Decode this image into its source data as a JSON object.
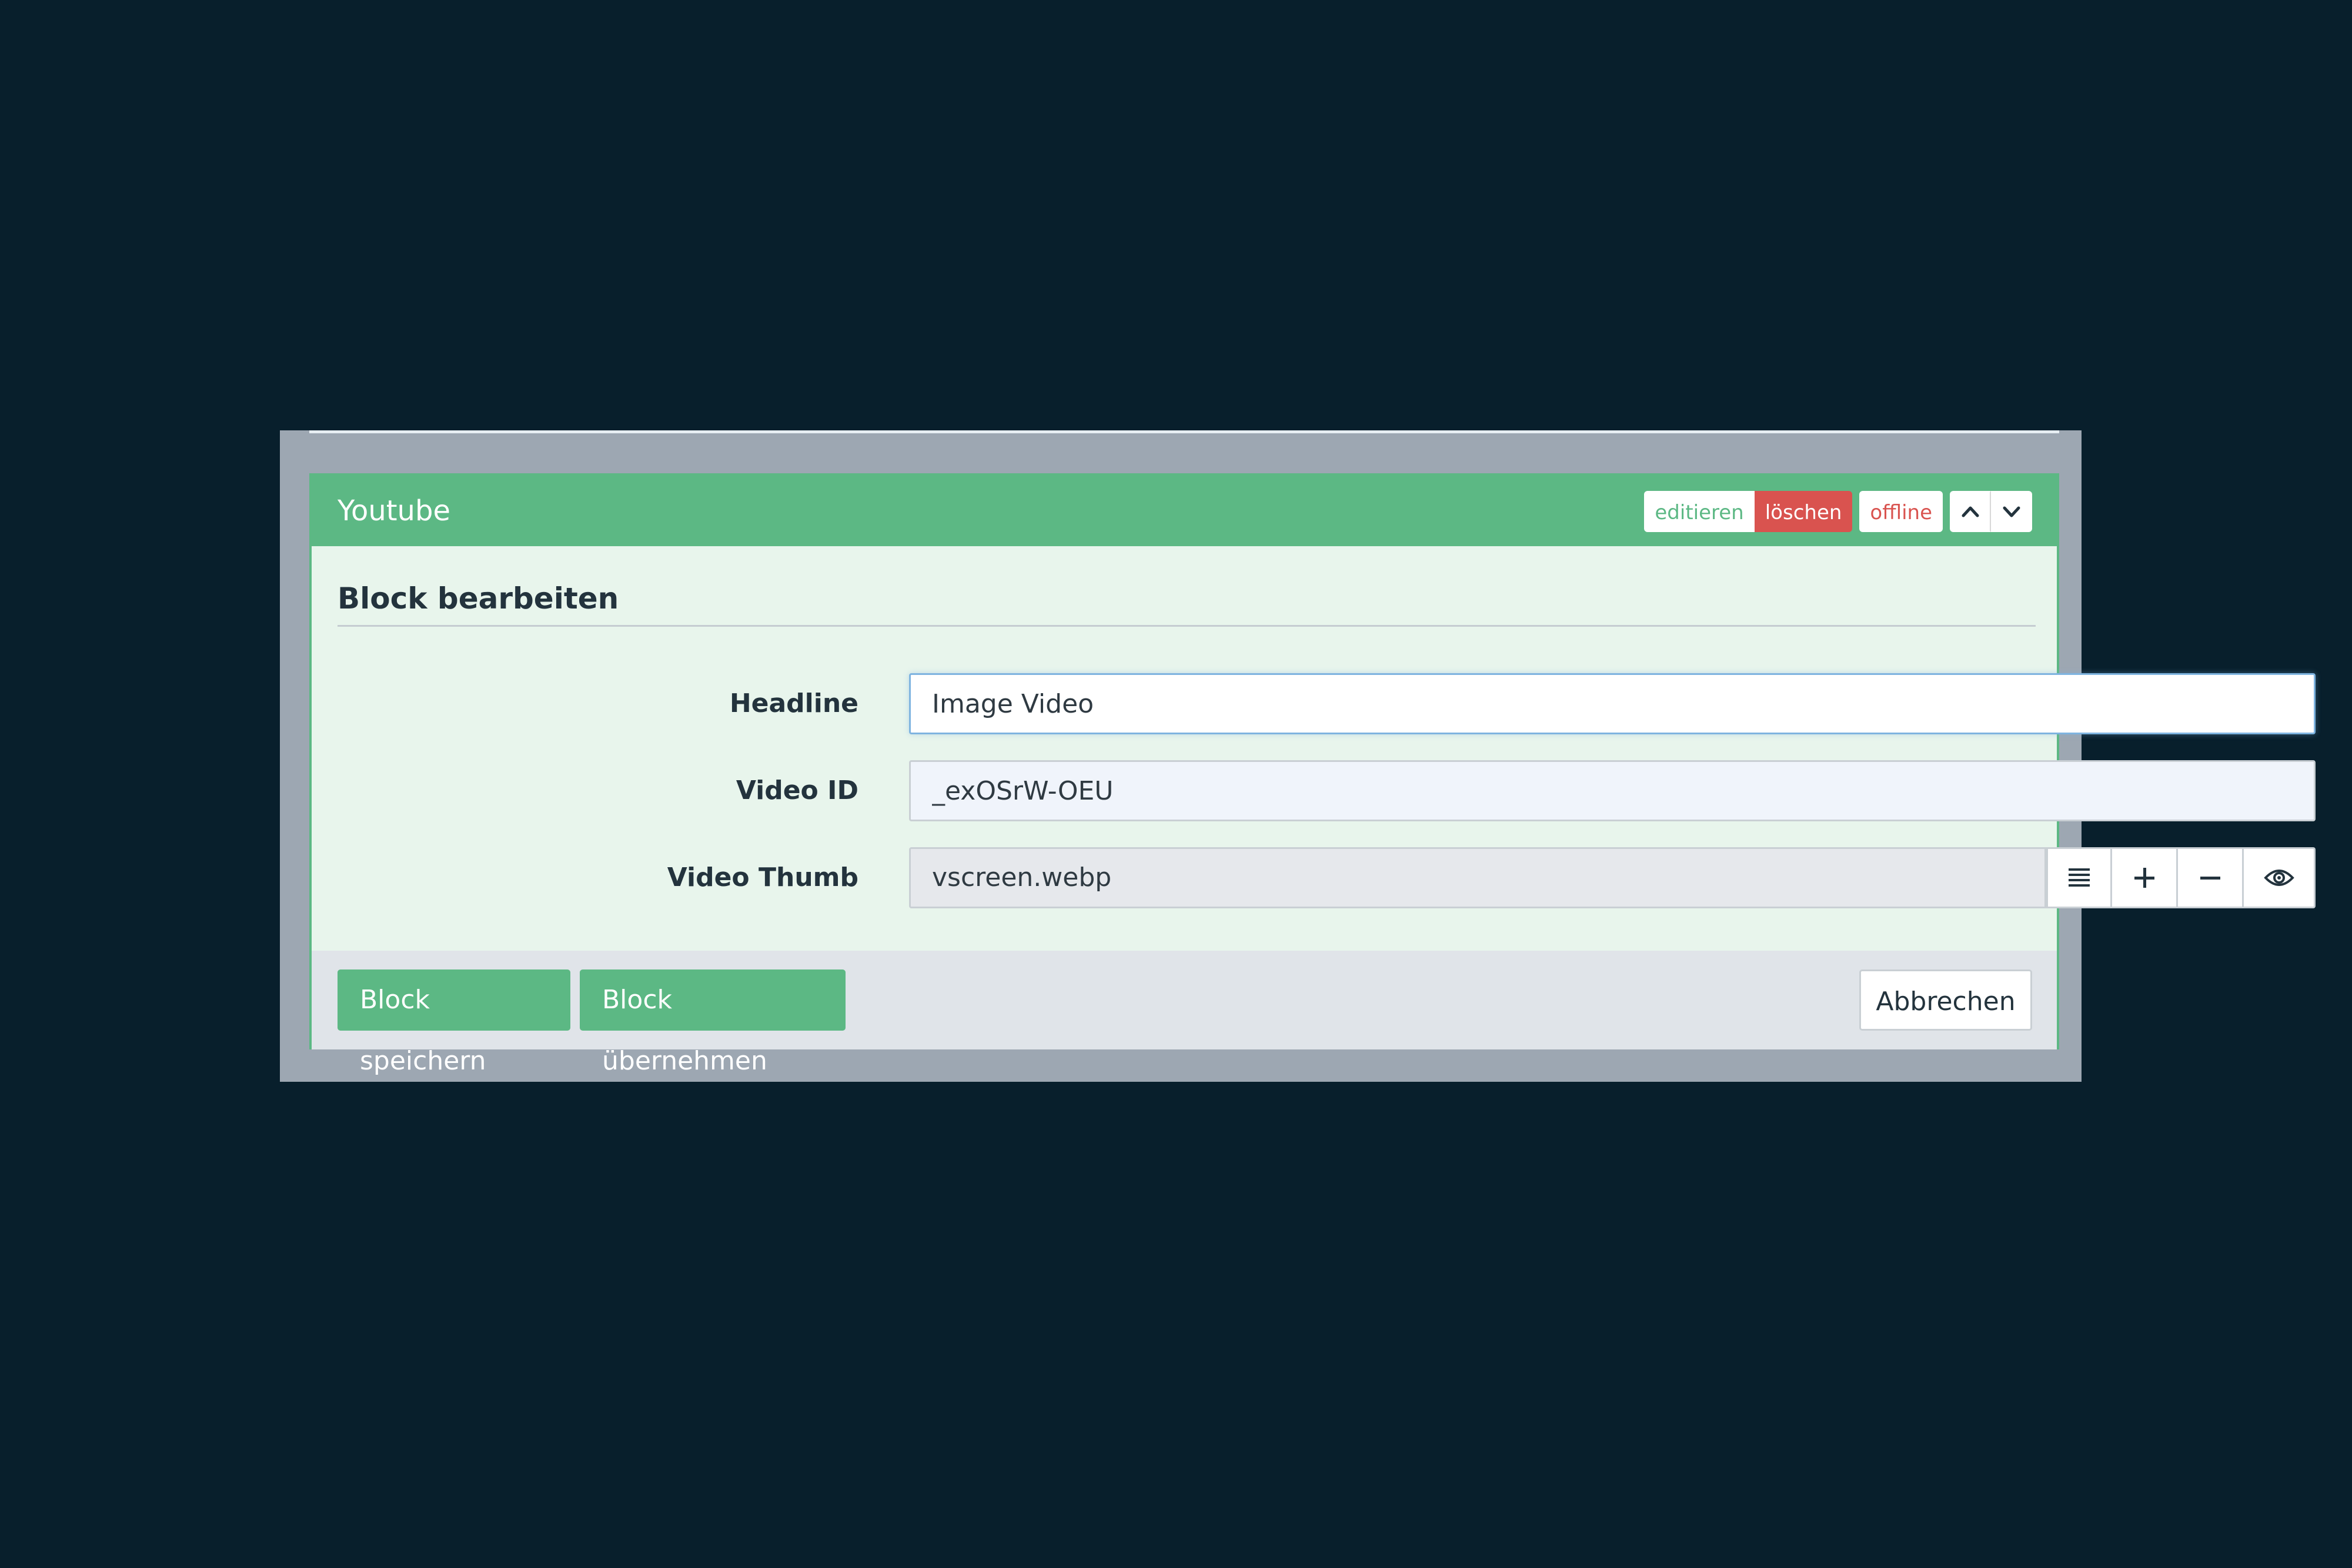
{
  "panel": {
    "title": "Youtube",
    "header_buttons": {
      "edit": "editieren",
      "delete": "löschen",
      "offline": "offline"
    }
  },
  "form": {
    "section_title": "Block bearbeiten",
    "fields": {
      "headline": {
        "label": "Headline",
        "value": "Image Video"
      },
      "video_id": {
        "label": "Video ID",
        "value": "_exOSrW-OEU"
      },
      "video_thumb": {
        "label": "Video Thumb",
        "value": "vscreen.webp"
      }
    }
  },
  "footer": {
    "save": "Block speichern",
    "apply": "Block übernehmen",
    "cancel": "Abbrechen"
  },
  "colors": {
    "accent_green": "#5cb884",
    "danger_red": "#d9534f",
    "background": "#081f2c"
  },
  "icons": {
    "up": "chevron-up-icon",
    "down": "chevron-down-icon",
    "list": "list-icon",
    "add": "plus-icon",
    "remove": "minus-icon",
    "view": "eye-icon"
  }
}
